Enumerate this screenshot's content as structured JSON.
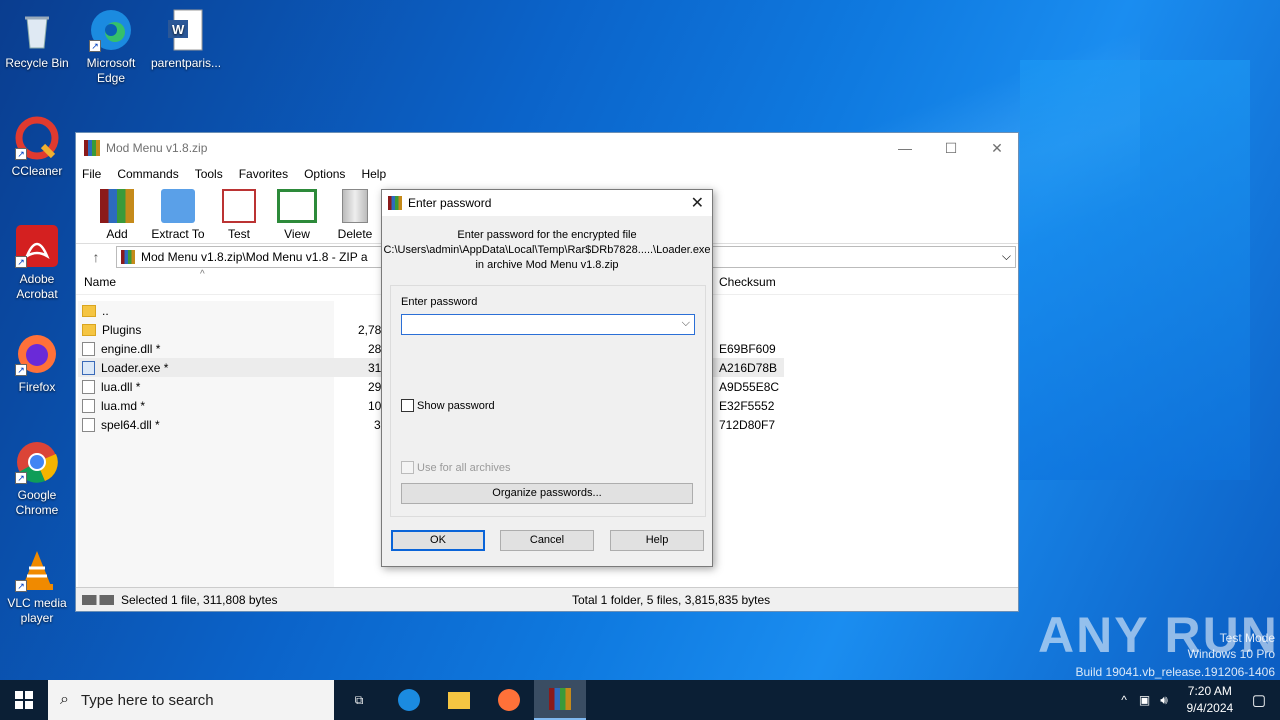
{
  "desktop": {
    "icons": [
      {
        "label": "Recycle Bin",
        "icon": "recycle-bin-icon"
      },
      {
        "label": "Microsoft Edge",
        "icon": "edge-icon"
      },
      {
        "label": "parentparis...",
        "icon": "word-document-icon"
      },
      {
        "label": "CCleaner",
        "icon": "ccleaner-icon"
      },
      {
        "label": "Adobe Acrobat",
        "icon": "acrobat-icon"
      },
      {
        "label": "Firefox",
        "icon": "firefox-icon"
      },
      {
        "label": "Google Chrome",
        "icon": "chrome-icon"
      },
      {
        "label": "VLC media player",
        "icon": "vlc-icon"
      }
    ]
  },
  "winrar": {
    "title": "Mod Menu v1.8.zip",
    "menu": [
      "File",
      "Commands",
      "Tools",
      "Favorites",
      "Options",
      "Help"
    ],
    "toolbar": [
      "Add",
      "Extract To",
      "Test",
      "View",
      "Delete"
    ],
    "address": "Mod Menu v1.8.zip\\Mod Menu v1.8 - ZIP a",
    "columns": {
      "name": "Name",
      "checksum": "Checksum"
    },
    "files": [
      {
        "name": "..",
        "size": "",
        "checksum": "",
        "type": "folder"
      },
      {
        "name": "Plugins",
        "size": "2,78",
        "checksum": "",
        "type": "folder"
      },
      {
        "name": "engine.dll *",
        "size": "28",
        "checksum": "E69BF609",
        "type": "file"
      },
      {
        "name": "Loader.exe *",
        "size": "31",
        "checksum": "A216D78B",
        "type": "exe"
      },
      {
        "name": "lua.dll *",
        "size": "29",
        "checksum": "A9D55E8C",
        "type": "file"
      },
      {
        "name": "lua.md *",
        "size": "10",
        "checksum": "E32F5552",
        "type": "file"
      },
      {
        "name": "spel64.dll *",
        "size": "3",
        "checksum": "712D80F7",
        "type": "file"
      }
    ],
    "status_left": "Selected 1 file, 311,808 bytes",
    "status_right": "Total 1 folder, 5 files, 3,815,835 bytes"
  },
  "dialog": {
    "title": "Enter password",
    "info_line1": "Enter password for the encrypted file",
    "info_line2": "C:\\Users\\admin\\AppData\\Local\\Temp\\Rar$DRb7828.....\\Loader.exe",
    "info_line3": "in archive Mod Menu v1.8.zip",
    "field_label": "Enter password",
    "password_value": "",
    "show_password": "Show password",
    "use_for_all": "Use for all archives",
    "organize": "Organize passwords...",
    "ok": "OK",
    "cancel": "Cancel",
    "help": "Help"
  },
  "watermark": {
    "brand": "ANY RUN",
    "line1": "Test Mode",
    "line2": "Windows 10 Pro",
    "line3": "Build 19041.vb_release.191206-1406"
  },
  "taskbar": {
    "search_placeholder": "Type here to search",
    "time": "7:20 AM",
    "date": "9/4/2024"
  }
}
